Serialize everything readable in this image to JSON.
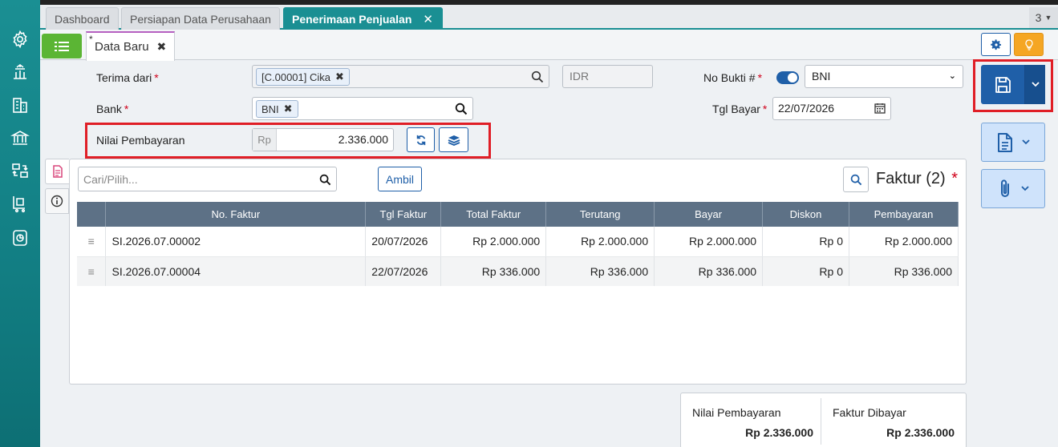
{
  "tabs": [
    {
      "label": "Dashboard"
    },
    {
      "label": "Persiapan Data Perusahaan"
    },
    {
      "label": "Penerimaan Penjualan"
    }
  ],
  "tab_count": "3",
  "subtab": {
    "marker": "*",
    "label": "Data Baru"
  },
  "form": {
    "terima_dari_label": "Terima dari",
    "terima_dari_value": "[C.00001] Cika",
    "currency": "IDR",
    "no_bukti_label": "No Bukti #",
    "no_bukti_value": "BNI",
    "bank_label": "Bank",
    "bank_value": "BNI",
    "tgl_bayar_label": "Tgl Bayar",
    "tgl_bayar_value": "22/07/2026",
    "nilai_label": "Nilai Pembayaran",
    "nilai_prefix": "Rp",
    "nilai_value": "2.336.000",
    "required_mark": "*"
  },
  "panel": {
    "search_placeholder": "Cari/Pilih...",
    "ambil_label": "Ambil",
    "title": "Faktur (2)",
    "title_mark": "*",
    "columns": [
      "No. Faktur",
      "Tgl Faktur",
      "Total Faktur",
      "Terutang",
      "Bayar",
      "Diskon",
      "Pembayaran"
    ],
    "rows": [
      {
        "no": "SI.2026.07.00002",
        "tgl": "20/07/2026",
        "total": "Rp 2.000.000",
        "terutang": "Rp 2.000.000",
        "bayar": "Rp 2.000.000",
        "diskon": "Rp 0",
        "pembayaran": "Rp 2.000.000"
      },
      {
        "no": "SI.2026.07.00004",
        "tgl": "22/07/2026",
        "total": "Rp 336.000",
        "terutang": "Rp 336.000",
        "bayar": "Rp 336.000",
        "diskon": "Rp 0",
        "pembayaran": "Rp 336.000"
      }
    ]
  },
  "summary": {
    "nilai_label": "Nilai Pembayaran",
    "nilai_value": "Rp 2.336.000",
    "faktur_label": "Faktur Dibayar",
    "faktur_value": "Rp 2.336.000"
  },
  "colors": {
    "sidebar": "#1a8f93",
    "accent": "#1f5fa8",
    "required": "#d0021b",
    "highlight": "#e01e26",
    "menu_green": "#5bb534",
    "bulb": "#f5a623"
  },
  "icons": [
    "gear-icon",
    "scale-icon",
    "building-icon",
    "bank-icon",
    "transfer-icon",
    "cart-icon",
    "report-icon",
    "menu-list-icon",
    "settings-icon",
    "bulb-icon",
    "save-icon",
    "document-icon",
    "paperclip-icon",
    "search-icon",
    "refresh-icon",
    "stack-icon",
    "info-icon",
    "calendar-icon"
  ]
}
